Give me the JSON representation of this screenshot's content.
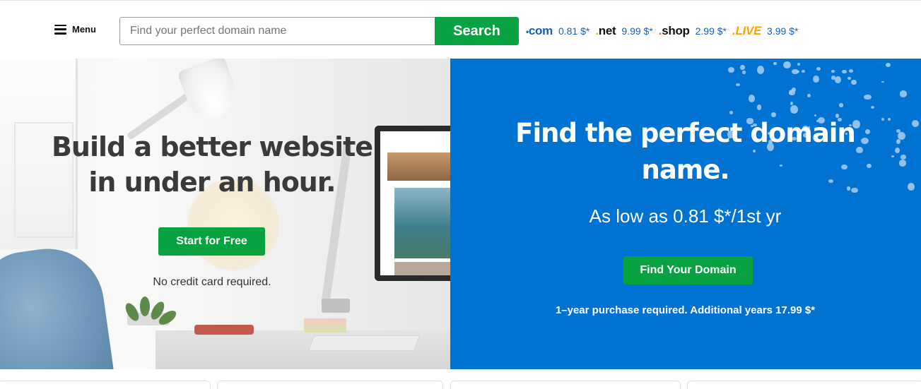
{
  "header": {
    "menu_label": "Menu",
    "search_placeholder": "Find your perfect domain name",
    "search_button": "Search",
    "tlds": [
      {
        "dot": "•",
        "name": "com",
        "price": "0.81 $*"
      },
      {
        "dot": ".",
        "name": "net",
        "price": "9.99 $*"
      },
      {
        "dot": ".",
        "name": "shop",
        "price": "2.99 $*"
      },
      {
        "dot": ".",
        "name": "LIVE",
        "price": "3.99 $*"
      }
    ]
  },
  "left_hero": {
    "title_line1": "Build a better website",
    "title_line2": "in under an hour.",
    "cta": "Start for Free",
    "note": "No credit card required."
  },
  "right_hero": {
    "title_line1": "Find the perfect domain",
    "title_line2": "name.",
    "subtitle": "As low as 0.81 $*/1st yr",
    "cta": "Find Your Domain",
    "fine_print": "1–year purchase required. Additional years 17.99 $*"
  },
  "colors": {
    "brand_green": "#09a241",
    "brand_blue": "#0073d2",
    "tld_blue": "#1b5fb8",
    "live_orange": "#f7a400"
  }
}
